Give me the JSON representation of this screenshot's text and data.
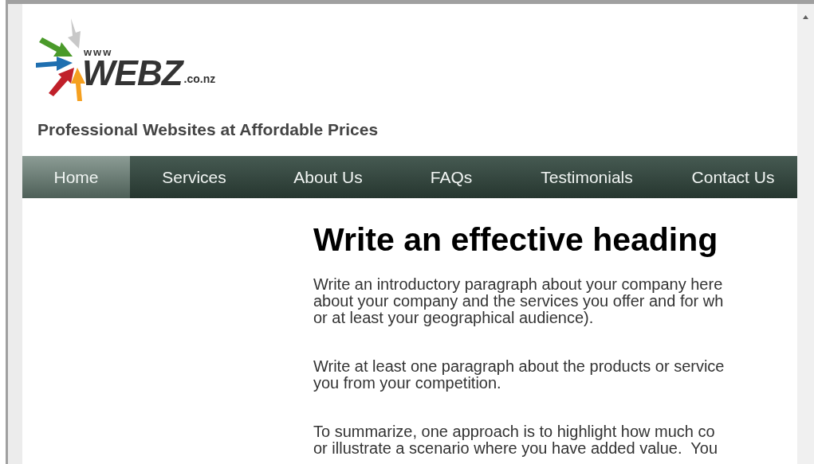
{
  "logo": {
    "prefix": "www",
    "name": "WEBZ",
    "suffix": ".co.nz"
  },
  "tagline": "Professional Websites at Affordable Prices",
  "nav": [
    {
      "label": "Home",
      "selected": true
    },
    {
      "label": "Services",
      "selected": false
    },
    {
      "label": "About Us",
      "selected": false
    },
    {
      "label": "FAQs",
      "selected": false
    },
    {
      "label": "Testimonials",
      "selected": false
    },
    {
      "label": "Contact Us",
      "selected": false
    }
  ],
  "heading": "Write an effective heading",
  "paragraphs": [
    [
      "Write an introductory paragraph about your company here",
      "about your company and the services you offer and for wh",
      "or at least your geographical audience)."
    ],
    [
      "Write at least one paragraph about the products or service",
      "you from your competition."
    ],
    [
      "To summarize, one approach is to highlight how much co",
      "or illustrate a scenario where you have added value.  You"
    ]
  ]
}
